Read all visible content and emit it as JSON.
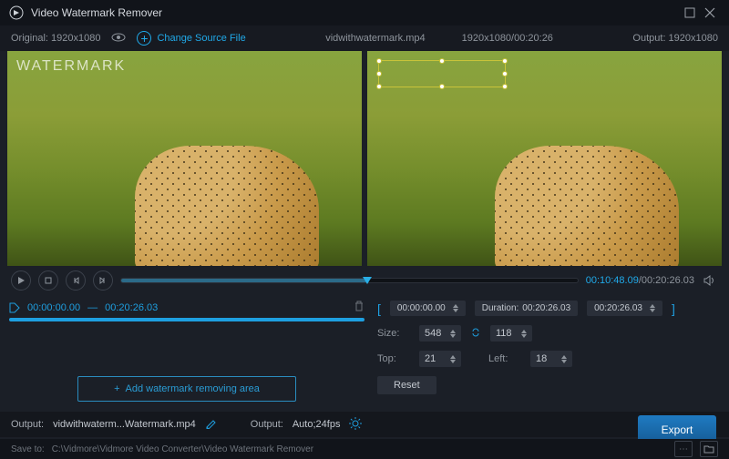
{
  "titlebar": {
    "title": "Video Watermark Remover"
  },
  "infobar": {
    "original": "Original:  1920x1080",
    "change_label": "Change Source File",
    "filename": "vidwithwatermark.mp4",
    "dims_time": "1920x1080/00:20:26",
    "output": "Output:  1920x1080"
  },
  "preview": {
    "watermark_text": "WATERMARK"
  },
  "player": {
    "current": "00:10:48.09",
    "total": "/00:20:26.03"
  },
  "segment": {
    "start": "00:00:00.00",
    "sep": "—",
    "end": "00:20:26.03",
    "add_label": "Add watermark removing area",
    "plus": "+"
  },
  "params": {
    "start": "00:00:00.00",
    "duration_label": "Duration:",
    "duration_value": "00:20:26.03",
    "end": "00:20:26.03",
    "size_label": "Size:",
    "width": "548",
    "height": "118",
    "top_label": "Top:",
    "top_value": "21",
    "left_label": "Left:",
    "left_value": "18",
    "reset_label": "Reset"
  },
  "outputbar": {
    "label1": "Output:",
    "file": "vidwithwaterm...Watermark.mp4",
    "label2": "Output:",
    "fmt": "Auto;24fps"
  },
  "savebar": {
    "label": "Save to:",
    "path": "C:\\Vidmore\\Vidmore Video Converter\\Video Watermark Remover"
  },
  "export": {
    "label": "Export"
  }
}
